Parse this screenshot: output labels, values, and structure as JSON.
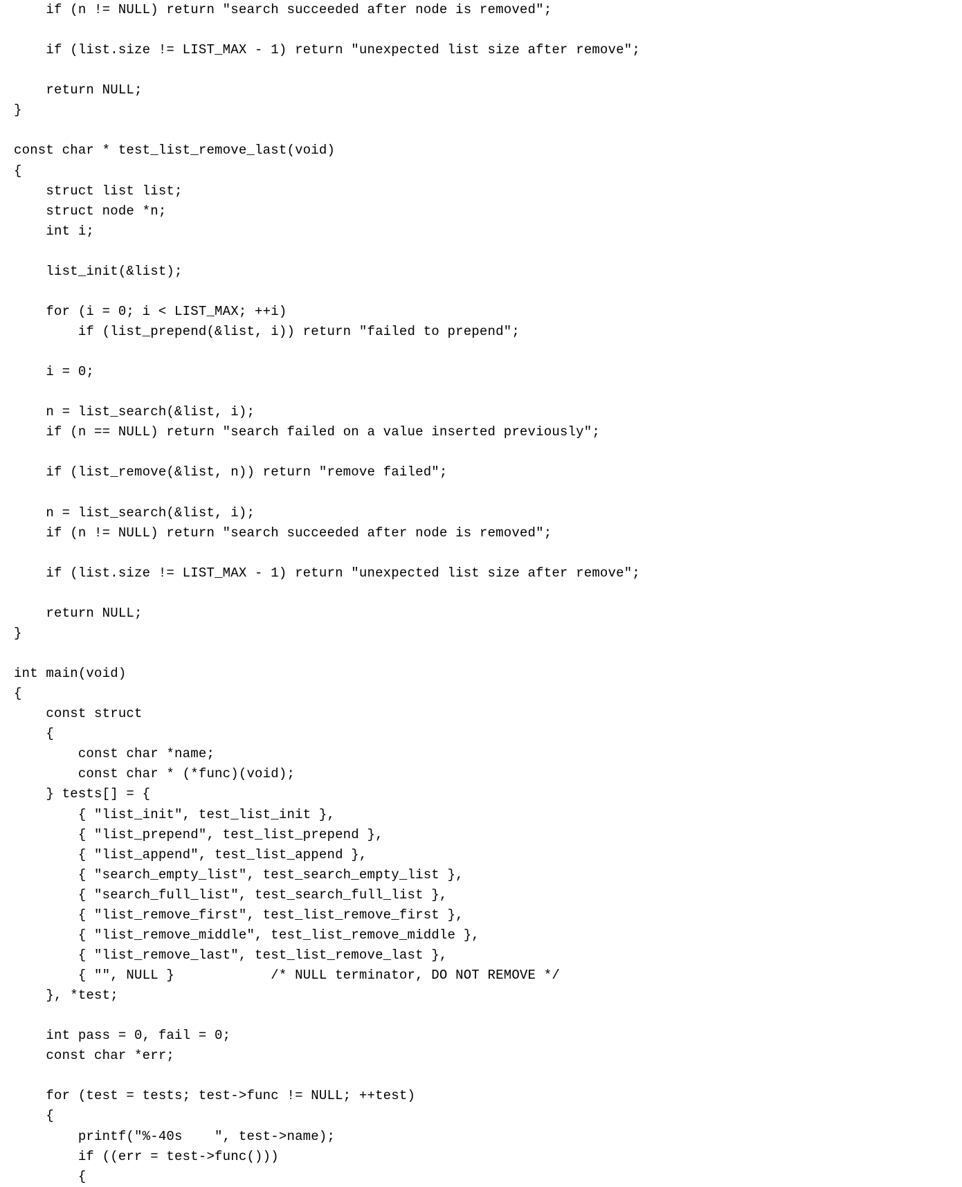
{
  "code": "    if (n != NULL) return \"search succeeded after node is removed\";\n\n    if (list.size != LIST_MAX - 1) return \"unexpected list size after remove\";\n\n    return NULL;\n}\n\nconst char * test_list_remove_last(void)\n{\n    struct list list;\n    struct node *n;\n    int i;\n\n    list_init(&list);\n\n    for (i = 0; i < LIST_MAX; ++i)\n        if (list_prepend(&list, i)) return \"failed to prepend\";\n\n    i = 0;\n\n    n = list_search(&list, i);\n    if (n == NULL) return \"search failed on a value inserted previously\";\n\n    if (list_remove(&list, n)) return \"remove failed\";\n\n    n = list_search(&list, i);\n    if (n != NULL) return \"search succeeded after node is removed\";\n\n    if (list.size != LIST_MAX - 1) return \"unexpected list size after remove\";\n\n    return NULL;\n}\n\nint main(void)\n{\n    const struct\n    {\n        const char *name;\n        const char * (*func)(void);\n    } tests[] = {\n        { \"list_init\", test_list_init },\n        { \"list_prepend\", test_list_prepend },\n        { \"list_append\", test_list_append },\n        { \"search_empty_list\", test_search_empty_list },\n        { \"search_full_list\", test_search_full_list },\n        { \"list_remove_first\", test_list_remove_first },\n        { \"list_remove_middle\", test_list_remove_middle },\n        { \"list_remove_last\", test_list_remove_last },\n        { \"\", NULL }            /* NULL terminator, DO NOT REMOVE */\n    }, *test;\n\n    int pass = 0, fail = 0;\n    const char *err;\n\n    for (test = tests; test->func != NULL; ++test)\n    {\n        printf(\"%-40s    \", test->name);\n        if ((err = test->func()))\n        {"
}
